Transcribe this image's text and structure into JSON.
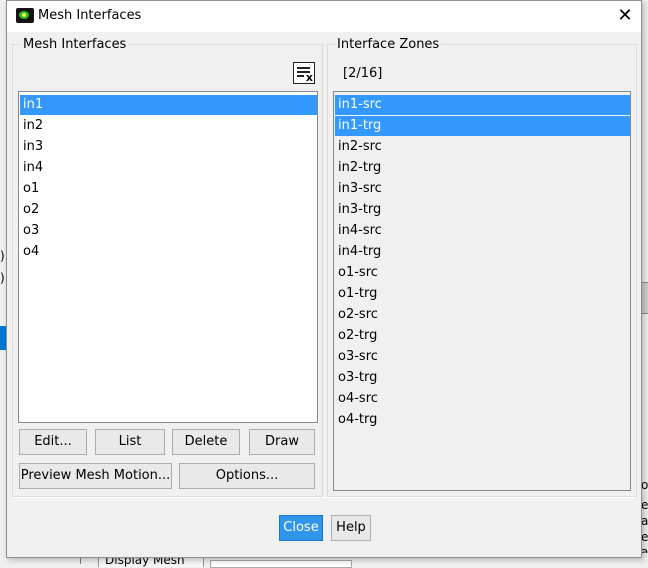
{
  "window": {
    "title": "Mesh Interfaces",
    "close_glyph": "✕"
  },
  "left_group": {
    "title": "Mesh Interfaces",
    "items": [
      {
        "label": "in1",
        "selected": true
      },
      {
        "label": "in2",
        "selected": false
      },
      {
        "label": "in3",
        "selected": false
      },
      {
        "label": "in4",
        "selected": false
      },
      {
        "label": "o1",
        "selected": false
      },
      {
        "label": "o2",
        "selected": false
      },
      {
        "label": "o3",
        "selected": false
      },
      {
        "label": "o4",
        "selected": false
      }
    ],
    "buttons": {
      "edit": "Edit...",
      "list": "List",
      "delete": "Delete",
      "draw": "Draw",
      "preview": "Preview Mesh Motion...",
      "options": "Options..."
    },
    "clear_icon_glyph": "x"
  },
  "right_group": {
    "title": "Interface Zones",
    "count": "[2/16]",
    "items": [
      {
        "label": "in1-src",
        "selected": true
      },
      {
        "label": "in1-trg",
        "selected": true
      },
      {
        "label": "in2-src",
        "selected": false
      },
      {
        "label": "in2-trg",
        "selected": false
      },
      {
        "label": "in3-src",
        "selected": false
      },
      {
        "label": "in3-trg",
        "selected": false
      },
      {
        "label": "in4-src",
        "selected": false
      },
      {
        "label": "in4-trg",
        "selected": false
      },
      {
        "label": "o1-src",
        "selected": false
      },
      {
        "label": "o1-trg",
        "selected": false
      },
      {
        "label": "o2-src",
        "selected": false
      },
      {
        "label": "o2-trg",
        "selected": false
      },
      {
        "label": "o3-src",
        "selected": false
      },
      {
        "label": "o3-trg",
        "selected": false
      },
      {
        "label": "o4-src",
        "selected": false
      },
      {
        "label": "o4-trg",
        "selected": false
      }
    ]
  },
  "footer": {
    "close": "Close",
    "help": "Help"
  },
  "background": {
    "tab_label": "Display Mesh",
    "fragments": [
      ")",
      ")",
      "ol",
      "e",
      "a",
      "e",
      "a"
    ]
  },
  "colors": {
    "selection": "#3399ff",
    "primary_button": "#2f96ec",
    "dialog_bg": "#f0f0f0"
  }
}
